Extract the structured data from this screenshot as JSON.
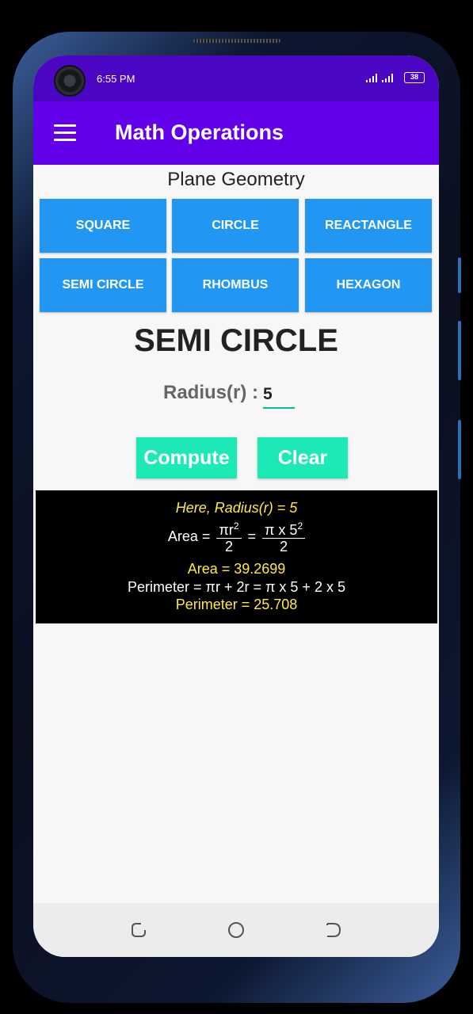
{
  "status_bar": {
    "time": "6:55 PM",
    "battery": "38"
  },
  "app_bar": {
    "title": "Math Operations"
  },
  "section_title": "Plane Geometry",
  "shape_buttons": [
    "SQUARE",
    "CIRCLE",
    "REACTANGLE",
    "SEMI CIRCLE",
    "RHOMBUS",
    "HEXAGON"
  ],
  "selected_shape": "SEMI CIRCLE",
  "form": {
    "radius_label": "Radius(r) :",
    "radius_value": "5"
  },
  "actions": {
    "compute_label": "Compute",
    "clear_label": "Clear"
  },
  "result": {
    "given": "Here, Radius(r) = 5",
    "area_prefix": "Area =",
    "area_frac1_num": "πr",
    "area_frac1_num_sup": "2",
    "area_frac1_den": "2",
    "equals": "=",
    "area_frac2_num": "π x 5",
    "area_frac2_num_sup": "2",
    "area_frac2_den": "2",
    "area_result": "Area = 39.2699",
    "perimeter_formula": "Perimeter = πr + 2r = π x 5 + 2 x 5",
    "perimeter_result": "Perimeter = 25.708"
  },
  "colors": {
    "status_bar": "#4b06c3",
    "app_bar": "#6200ea",
    "shape_button": "#2196f3",
    "action_button": "#1de9b6",
    "result_highlight": "#ffeb3b"
  }
}
